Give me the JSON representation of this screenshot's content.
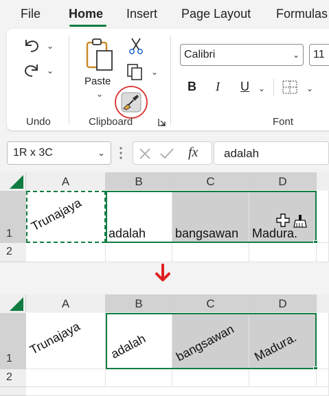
{
  "ribbon_tabs": [
    {
      "label": "File",
      "active": false
    },
    {
      "label": "Home",
      "active": true
    },
    {
      "label": "Insert",
      "active": false
    },
    {
      "label": "Page Layout",
      "active": false
    },
    {
      "label": "Formulas",
      "active": false
    }
  ],
  "groups": {
    "undo": "Undo",
    "clipboard": "Clipboard",
    "font": "Font"
  },
  "clipboard": {
    "paste_label": "Paste"
  },
  "font": {
    "name": "Calibri",
    "size": "11",
    "bold": "B",
    "italic": "I",
    "underline": "U"
  },
  "formula_bar": {
    "name_box": "1R x 3C",
    "fx_label": "fx",
    "formula": "adalah"
  },
  "columns": [
    "A",
    "B",
    "C",
    "D"
  ],
  "rows": [
    "1",
    "2"
  ],
  "sheet_before": {
    "cells": {
      "A1": "Trunajaya",
      "B1": "adalah",
      "C1": "bangsawan",
      "D1": "Madura."
    }
  },
  "sheet_after": {
    "cells": {
      "A1": "Trunajaya",
      "B1": "adalah",
      "C1": "bangsawan",
      "D1": "Madura."
    }
  },
  "colors": {
    "accent": "#107c41",
    "arrow": "#e02020",
    "highlight_circle": "#d9302c",
    "selected_header": "#d2d2d2",
    "selected_cell": "#cfcfcf"
  }
}
